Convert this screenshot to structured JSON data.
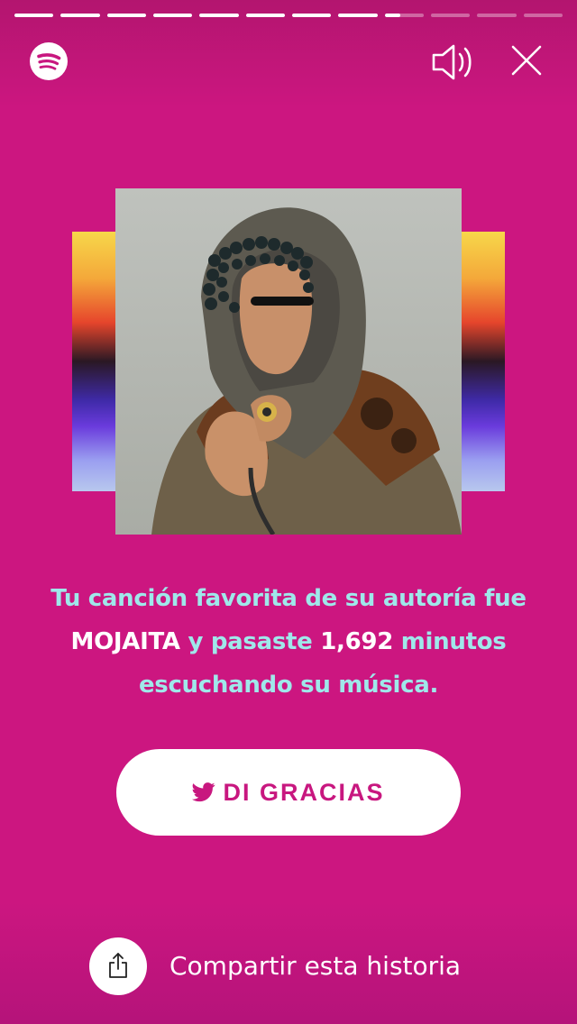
{
  "story": {
    "segments": [
      1,
      1,
      1,
      1,
      1,
      1,
      1,
      1,
      0.4,
      0,
      0,
      0
    ]
  },
  "header": {
    "logo_icon": "spotify-logo",
    "sound_icon": "speaker-icon",
    "close_icon": "close-icon"
  },
  "caption": {
    "line1": "Tu canción favorita de su autoría fue",
    "song": "MOJAITA",
    "mid": " y pasaste ",
    "minutes": "1,692",
    "after": " minutos",
    "line3": "escuchando su música."
  },
  "thanks_button": {
    "icon": "twitter-icon",
    "label": "DI GRACIAS"
  },
  "share": {
    "icon": "share-icon",
    "label": "Compartir esta historia"
  },
  "colors": {
    "background": "#cc1680",
    "caption": "#9fe8ea",
    "highlight": "#ffffff"
  }
}
